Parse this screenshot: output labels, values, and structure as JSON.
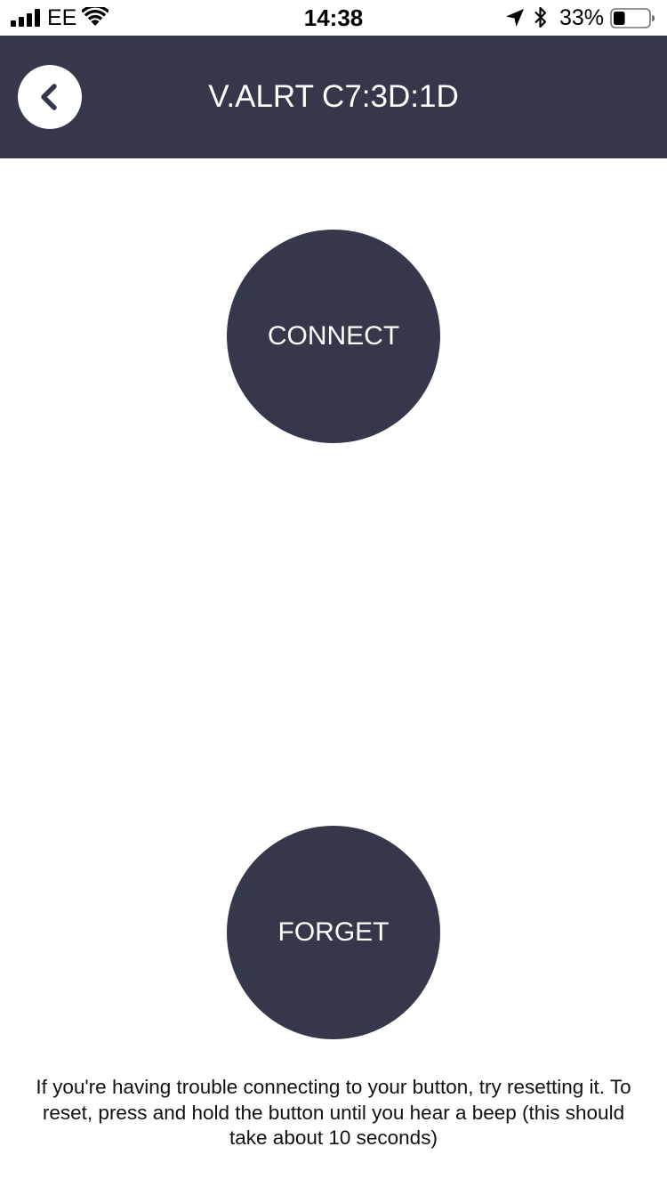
{
  "status_bar": {
    "carrier": "EE",
    "time": "14:38",
    "battery_percent": "33%",
    "battery_level": 0.33,
    "icons": [
      "signal-icon",
      "wifi-icon",
      "location-arrow-icon",
      "bluetooth-icon",
      "battery-icon"
    ]
  },
  "header": {
    "title": "V.ALRT C7:3D:1D",
    "back_icon": "chevron-left-icon"
  },
  "actions": {
    "connect_label": "CONNECT",
    "forget_label": "FORGET"
  },
  "help": {
    "text": "If you're having trouble connecting to your button, try resetting it. To reset, press and hold the button until you hear a beep (this should take about 10 seconds)"
  },
  "colors": {
    "primary_dark": "#35374b",
    "background": "#ffffff",
    "text": "#111111"
  }
}
